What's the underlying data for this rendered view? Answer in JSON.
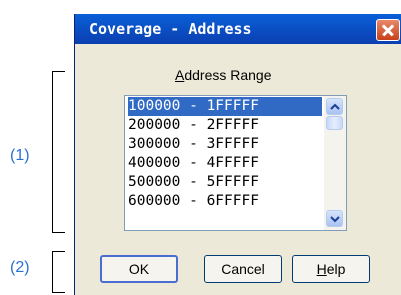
{
  "annotations": {
    "label1": "(1)",
    "label2": "(2)"
  },
  "dialog": {
    "title": "Coverage - Address",
    "group_label_accel": "A",
    "group_label_rest": "ddress Range",
    "list": {
      "items": [
        {
          "label": "100000 - 1FFFFF",
          "selected": true
        },
        {
          "label": "200000 - 2FFFFF",
          "selected": false
        },
        {
          "label": "300000 - 3FFFFF",
          "selected": false
        },
        {
          "label": "400000 - 4FFFFF",
          "selected": false
        },
        {
          "label": "500000 - 5FFFFF",
          "selected": false
        },
        {
          "label": "600000 - 6FFFFF",
          "selected": false
        }
      ]
    },
    "buttons": {
      "ok": "OK",
      "cancel": "Cancel",
      "help_accel": "H",
      "help_rest": "elp"
    }
  }
}
